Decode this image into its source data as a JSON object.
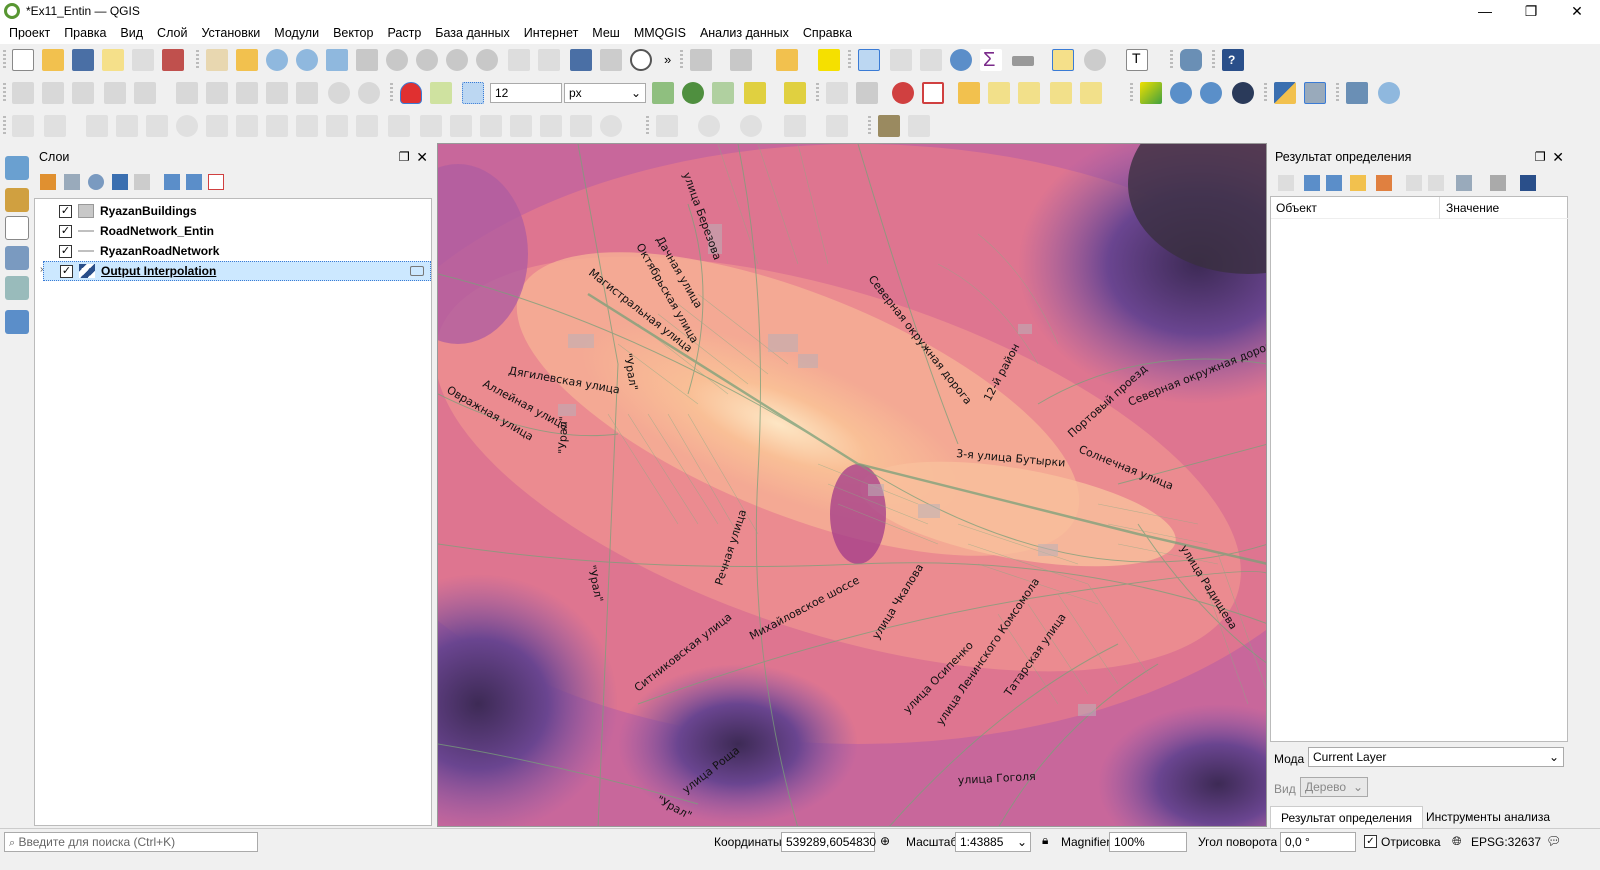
{
  "window": {
    "title": "*Ex11_Entin — QGIS",
    "minimize": "—",
    "maximize": "❐",
    "close": "✕"
  },
  "menu": [
    "Проект",
    "Правка",
    "Вид",
    "Слой",
    "Установки",
    "Модули",
    "Вектор",
    "Растр",
    "База данных",
    "Интернет",
    "Меш",
    "MMQGIS",
    "Анализ данных",
    "Справка"
  ],
  "toolbar": {
    "snap_value": "12",
    "snap_unit": "px"
  },
  "layers_panel": {
    "title": "Слои",
    "layers": [
      {
        "name": "RyazanBuildings",
        "checked": true
      },
      {
        "name": "RoadNetwork_Entin",
        "checked": true
      },
      {
        "name": "RyazanRoadNetwork",
        "checked": true
      },
      {
        "name": "Output Interpolation",
        "checked": true,
        "selected": true
      }
    ]
  },
  "map": {
    "labels": [
      "улица Березова",
      "Дачная улица",
      "Октябрьская улица",
      "Магистральная улица",
      "\"Урал\"",
      "Дягилевская улица",
      "Аллейная улица",
      "Овражная улица",
      "Северная окружная дорога",
      "12-й район",
      "Портовый проезд",
      "Северная окружная дорога",
      "3-я улица Бутырки",
      "Солнечная улица",
      "Речная улица",
      "улица Радищева",
      "Михайловское шоссе",
      "улица Чкалова",
      "Ситниковская улица",
      "улица Осипенко",
      "улица Ленинского Комсомола",
      "Татарская улица",
      "\"Урал\"",
      "улица Гоголя",
      "улица Роща",
      "\"Урал\"",
      "\"Урал\""
    ]
  },
  "identify_panel": {
    "title": "Результат определения",
    "col_object": "Объект",
    "col_value": "Значение",
    "mode_label": "Мода",
    "mode_value": "Current Layer",
    "view_label": "Вид",
    "view_value": "Дерево",
    "tab_results": "Результат определения",
    "tab_tools": "Инструменты анализа"
  },
  "statusbar": {
    "search_placeholder": "Введите для поиска (Ctrl+K)",
    "coords_label": "Координаты",
    "coords_value": "539289,6054830",
    "scale_label": "Масштаб",
    "scale_value": "1:43885",
    "magnifier_label": "Magnifier",
    "magnifier_value": "100%",
    "rotation_label": "Угол поворота",
    "rotation_value": "0,0 °",
    "render_label": "Отрисовка",
    "crs": "EPSG:32637"
  },
  "colors": {
    "accent": "#589632",
    "selection": "#cce8ff",
    "map_hot": "#fbd5a8",
    "map_mid": "#e8788f",
    "map_cold": "#5a3d7a"
  }
}
